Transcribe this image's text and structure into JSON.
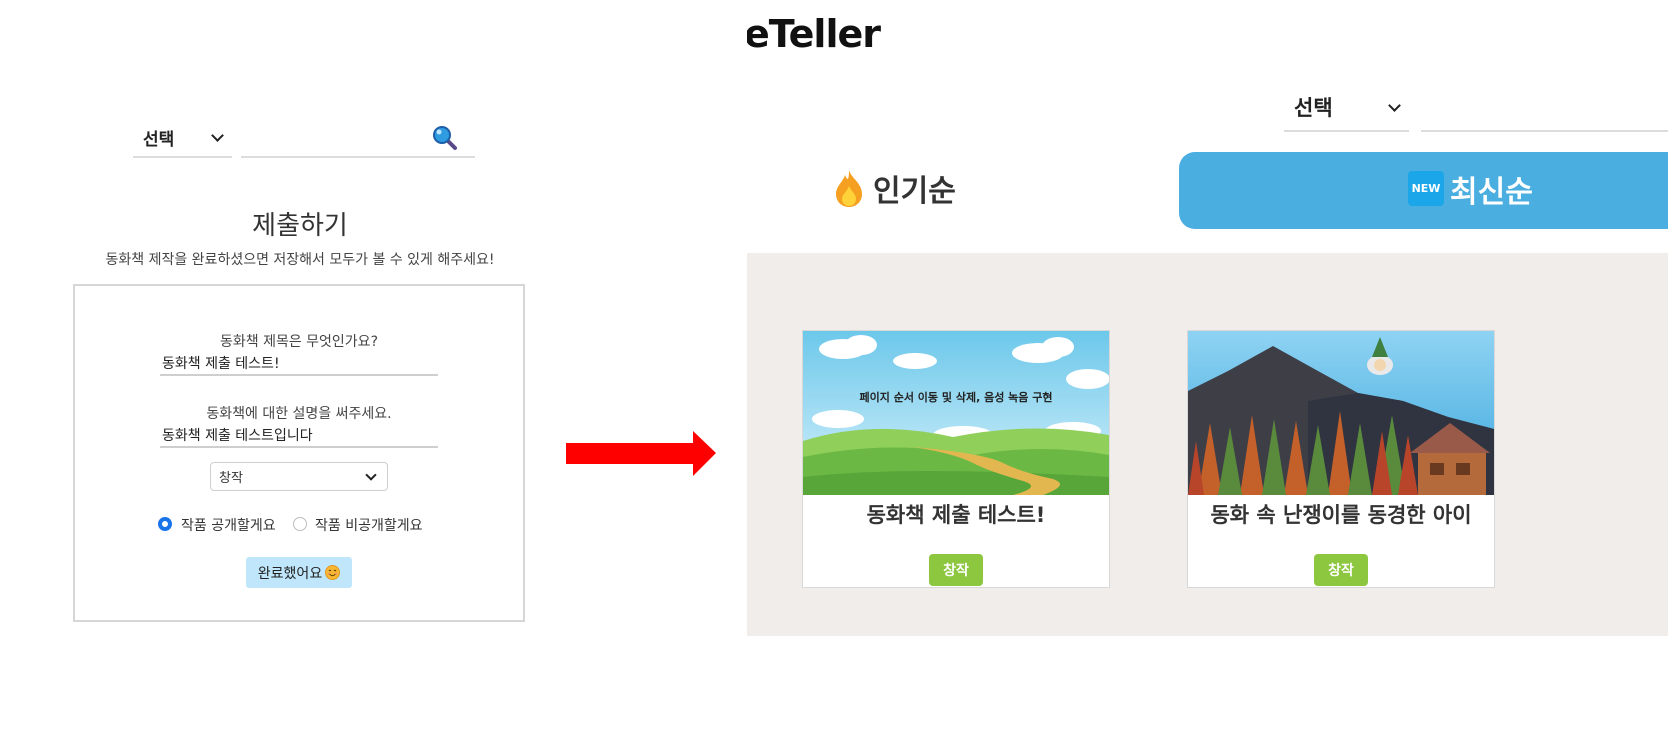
{
  "left": {
    "search": {
      "select_value": "선택"
    },
    "form": {
      "title": "제출하기",
      "subtitle": "동화책 제작을 완료하셨으면 저장해서 모두가 볼 수 있게 해주세요!",
      "title_question": "동화책 제목은 무엇인가요?",
      "title_value": "동화책 제출 테스트!",
      "desc_question": "동화책에 대한 설명을 써주세요.",
      "desc_value": "동화책 제출 테스트입니다",
      "category_value": "창작",
      "radio_public": "작품 공개할게요",
      "radio_private": "작품 비공개할게요",
      "submit_label": "완료했어요"
    }
  },
  "arrow": {
    "color": "#ff0000"
  },
  "right": {
    "brand": "eTeller",
    "search": {
      "select_value": "선택"
    },
    "tabs": [
      {
        "label": "인기순",
        "active": false,
        "icon": "fire-icon"
      },
      {
        "label": "최신순",
        "active": true,
        "badge": "NEW"
      }
    ],
    "cards": [
      {
        "cover_text": "페이지 순서 이동 및 삭제, 음성 녹음 구현",
        "title": "동화책 제출 테스트!",
        "category": "창작"
      },
      {
        "cover_text": "",
        "title": "동화 속 난쟁이를 동경한 아이",
        "category": "창작"
      }
    ]
  },
  "colors": {
    "accent_blue": "#4aaee0",
    "category_green": "#8dc63f",
    "radio_blue": "#1a73e8",
    "submit_bg": "#bfe6fb"
  }
}
